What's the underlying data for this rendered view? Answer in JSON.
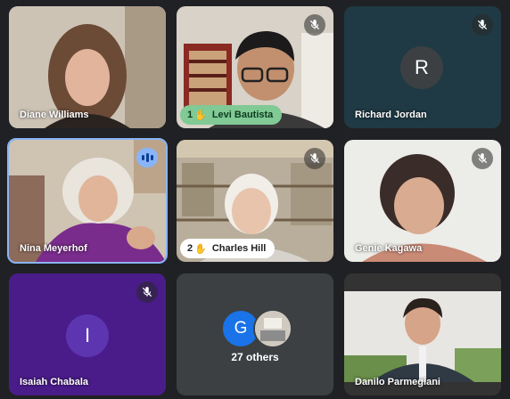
{
  "colors": {
    "background": "#202124",
    "active_speaker_border": "#8ab4f8",
    "raised_hand_pill_green": "#81c995",
    "avatar_richard": "#3c4043",
    "avatar_isaiah": "#5e35b1",
    "avatar_g": "#1a73e8"
  },
  "participants": [
    {
      "name": "Diane Williams",
      "video": true,
      "muted": false
    },
    {
      "name": "Levi Bautista",
      "video": true,
      "muted": true,
      "raised_hand_order": "1"
    },
    {
      "name": "Richard Jordan",
      "video": false,
      "avatar_letter": "R",
      "muted": true
    },
    {
      "name": "Nina Meyerhof",
      "video": true,
      "speaking": true
    },
    {
      "name": "Charles Hill",
      "video": true,
      "muted": true,
      "raised_hand_order": "2"
    },
    {
      "name": "Genie Kagawa",
      "video": true,
      "muted": true
    },
    {
      "name": "Isaiah Chabala",
      "video": false,
      "avatar_letter": "I",
      "muted": true
    },
    {
      "name": "Danilo Parmegiani",
      "video": true,
      "muted": false
    }
  ],
  "others_tile": {
    "avatar_letter": "G",
    "label": "27 others"
  },
  "icons": {
    "mic_off": "mic-off-icon",
    "raised_hand": "raised-hand-icon",
    "speaking": "audio-level-icon"
  }
}
